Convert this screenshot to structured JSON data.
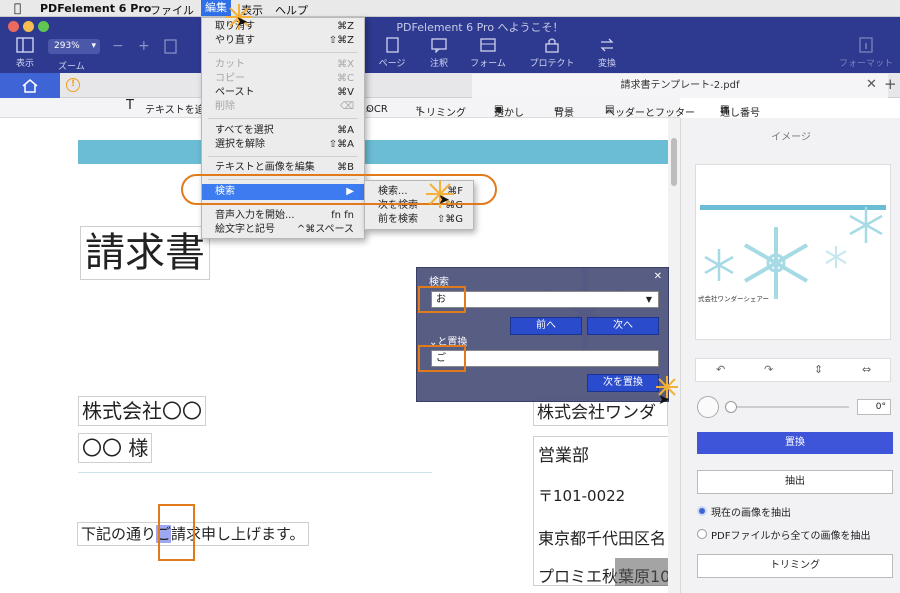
{
  "menubar": {
    "app_name": "PDFelement 6 Pro",
    "file": "ファイル",
    "edit": "編集",
    "view": "表示",
    "help": "ヘルプ"
  },
  "window": {
    "title": "PDFelement 6 Pro へようこそ！"
  },
  "toolbar": {
    "view": "表示",
    "zoom_label": "ズーム",
    "zoom_value": "293%",
    "page": "ページ",
    "annotate": "注釈",
    "form": "フォーム",
    "protect": "プロテクト",
    "convert": "変換",
    "format": "フォーマット"
  },
  "tab": {
    "doc_name": "請求書テンプレート-2.pdf"
  },
  "edit_tools": {
    "add_text": "テキストを追",
    "ocr": "OCR",
    "crop": "トリミング",
    "watermark": "透かし",
    "background": "背景",
    "header_footer": "ヘッダーとフッター",
    "bates": "通し番号"
  },
  "edit_menu": {
    "undo": {
      "label": "取り消す",
      "shortcut": "⌘Z"
    },
    "redo": {
      "label": "やり直す",
      "shortcut": "⇧⌘Z"
    },
    "cut": {
      "label": "カット",
      "shortcut": "⌘X"
    },
    "copy": {
      "label": "コピー",
      "shortcut": "⌘C"
    },
    "paste": {
      "label": "ペースト",
      "shortcut": "⌘V"
    },
    "delete": {
      "label": "削除",
      "shortcut": "⌫"
    },
    "select_all": {
      "label": "すべてを選択",
      "shortcut": "⌘A"
    },
    "deselect": {
      "label": "選択を解除",
      "shortcut": "⇧⌘A"
    },
    "edit_text_image": {
      "label": "テキストと画像を編集",
      "shortcut": "⌘B"
    },
    "find": {
      "label": "検索",
      "shortcut": "▶"
    },
    "dictation": {
      "label": "音声入力を開始...",
      "shortcut": "fn fn"
    },
    "emoji": {
      "label": "絵文字と記号",
      "shortcut": "^⌘スペース"
    }
  },
  "find_submenu": {
    "find": {
      "label": "検索...",
      "shortcut": "⌘F"
    },
    "find_next": {
      "label": "次を検索",
      "shortcut": "⌘G"
    },
    "find_prev": {
      "label": "前を検索",
      "shortcut": "⇧⌘G"
    }
  },
  "find_panel": {
    "search_label": "検索",
    "search_value": "お",
    "prev_button": "前へ",
    "next_button": "次へ",
    "replace_label": "と置換",
    "replace_value": "ご",
    "replace_button": "次を置換"
  },
  "document": {
    "title": "請求書",
    "company": "株式会社〇〇",
    "recipient": "〇〇 様",
    "body_pre": "下記の通り",
    "body_highlight": "ご",
    "body_post": "請求申し上げます。",
    "right_company": "株式会社ワンダ",
    "right_dept": "営業部",
    "right_zip": "〒101-0022",
    "right_address": "東京都千代田区名",
    "right_building": "プロミエ秋葉原10"
  },
  "right_panel": {
    "title": "イメージ",
    "thumb_company": "式会社ワンダーシェアー",
    "rotation_value": "0°",
    "replace_button": "置換",
    "extract_button": "抽出",
    "option_current": "現在の画像を抽出",
    "option_all": "PDFファイルから全ての画像を抽出",
    "crop_button": "トリミング"
  },
  "colors": {
    "menubar_bg": "#e9e9e9",
    "titlebar_bg": "#2d3a8f",
    "accent_blue": "#3f64d6",
    "highlight_orange": "#e07b1c",
    "doc_header_band": "#6bbdd6"
  }
}
